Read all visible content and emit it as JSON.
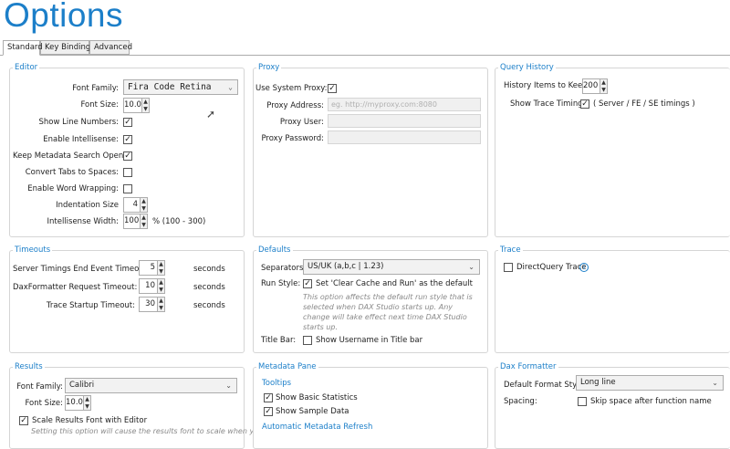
{
  "page": {
    "title": "Options"
  },
  "tabs": [
    {
      "label": "Standard",
      "active": true
    },
    {
      "label": "Key Bindings",
      "active": false
    },
    {
      "label": "Advanced",
      "active": false
    }
  ],
  "editor": {
    "title": "Editor",
    "font_family_label": "Font Family:",
    "font_family_value": "Fira Code Retina",
    "font_size_label": "Font Size:",
    "font_size_value": "10.0",
    "show_line_numbers_label": "Show Line Numbers:",
    "show_line_numbers_checked": true,
    "enable_intellisense_label": "Enable Intellisense:",
    "enable_intellisense_checked": true,
    "keep_metadata_label": "Keep Metadata Search Open:",
    "keep_metadata_checked": true,
    "convert_tabs_label": "Convert Tabs to Spaces:",
    "convert_tabs_checked": false,
    "word_wrap_label": "Enable Word Wrapping:",
    "word_wrap_checked": false,
    "indent_label": "Indentation Size",
    "indent_value": "4",
    "intellisense_width_label": "Intellisense Width:",
    "intellisense_width_value": "100",
    "intellisense_width_range": "% (100 - 300)"
  },
  "proxy": {
    "title": "Proxy",
    "use_system_label": "Use System Proxy:",
    "use_system_checked": true,
    "address_label": "Proxy Address:",
    "address_placeholder": "eg. http://myproxy.com:8080",
    "user_label": "Proxy User:",
    "password_label": "Proxy Password:"
  },
  "query_history": {
    "title": "Query History",
    "items_label": "History Items to Keep:",
    "items_value": "200",
    "trace_timings_label": "Show Trace Timings:",
    "trace_timings_checked": true,
    "trace_timings_note": "( Server / FE / SE timings )"
  },
  "timeouts": {
    "title": "Timeouts",
    "rows": [
      {
        "label": "Server Timings End Event Timeout:",
        "value": "5",
        "unit": "seconds"
      },
      {
        "label": "DaxFormatter Request Timeout:",
        "value": "10",
        "unit": "seconds"
      },
      {
        "label": "Trace Startup Timeout:",
        "value": "30",
        "unit": "seconds"
      }
    ]
  },
  "defaults": {
    "title": "Defaults",
    "separators_label": "Separators:",
    "separators_value": "US/UK (a,b,c | 1.23)",
    "run_style_label": "Run Style:",
    "run_style_checked": true,
    "run_style_text": "Set 'Clear Cache and Run' as the default",
    "run_style_note": "This option affects the default run style that is selected when DAX Studio starts up. Any change will take effect next time DAX Studio starts up.",
    "title_bar_label": "Title Bar:",
    "title_bar_checked": false,
    "title_bar_text": "Show Username in Title bar"
  },
  "trace": {
    "title": "Trace",
    "directquery_label": "DirectQuery Trace",
    "directquery_checked": false,
    "info_glyph": "i"
  },
  "results": {
    "title": "Results",
    "font_family_label": "Font Family:",
    "font_family_value": "Calibri",
    "font_size_label": "Font Size:",
    "font_size_value": "10.0",
    "scale_label": "Scale Results Font with Editor",
    "scale_checked": true,
    "scale_note": "Setting this option will cause the results font to scale when you"
  },
  "metadata_pane": {
    "title": "Metadata Pane",
    "tooltips_header": "Tooltips",
    "basic_stats_label": "Show Basic Statistics",
    "basic_stats_checked": true,
    "sample_data_label": "Show Sample Data",
    "sample_data_checked": true,
    "auto_refresh_header": "Automatic Metadata Refresh"
  },
  "dax_formatter": {
    "title": "Dax Formatter",
    "format_style_label": "Default Format Style:",
    "format_style_value": "Long line",
    "spacing_label": "Spacing:",
    "skip_space_label": "Skip space after function name",
    "skip_space_checked": false
  },
  "glyphs": {
    "check": "✓",
    "dropdown": "⌄",
    "spin_up": "▲",
    "spin_down": "▼",
    "cursor": "➚"
  },
  "colors": {
    "accent": "#1c7fc9"
  }
}
